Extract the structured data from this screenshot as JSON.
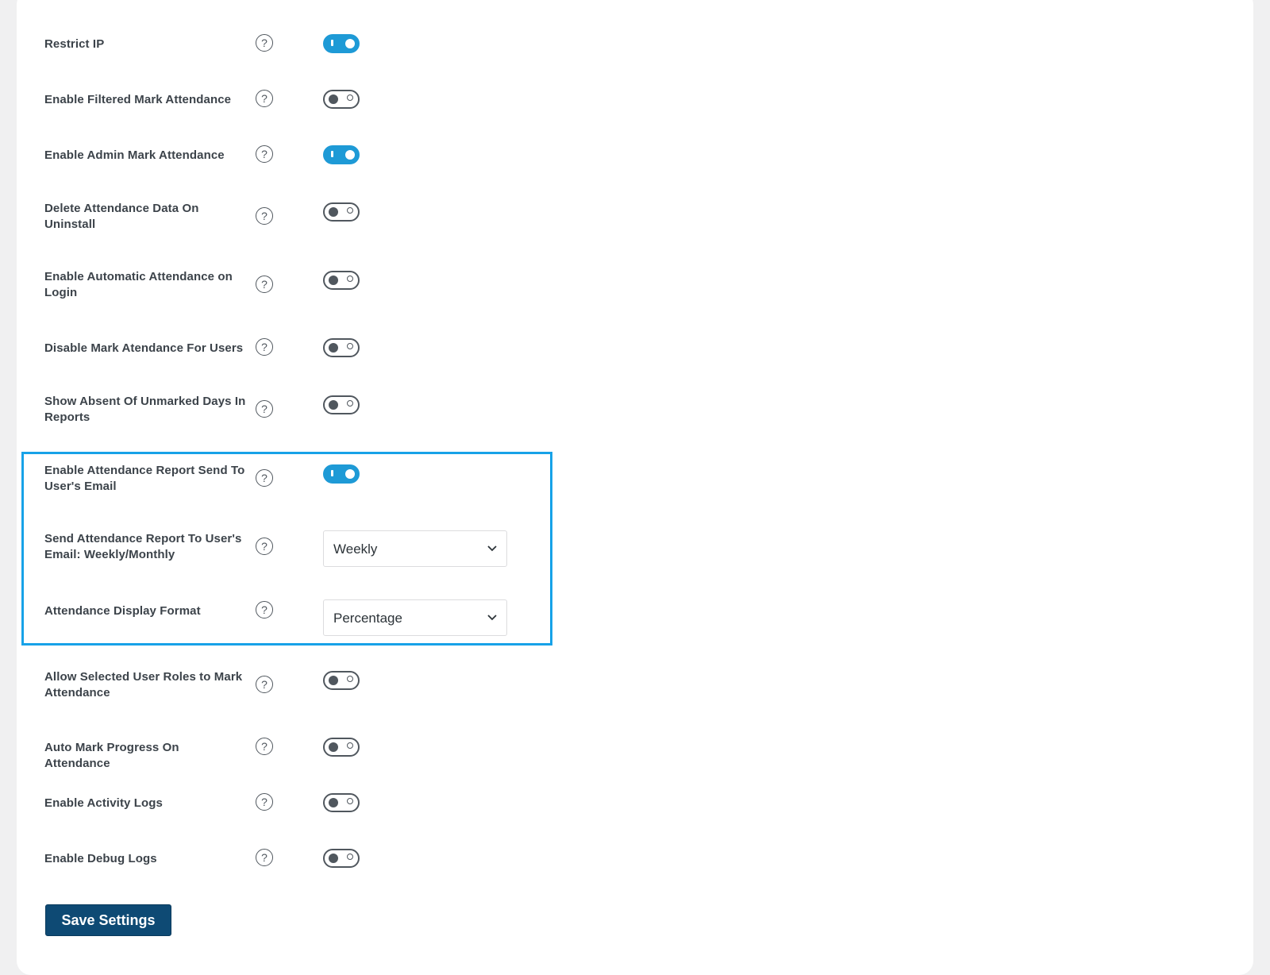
{
  "settings": [
    {
      "label": "Restrict IP",
      "control": "toggle",
      "state": "on"
    },
    {
      "label": "Enable Filtered Mark Attendance",
      "control": "toggle",
      "state": "off"
    },
    {
      "label": "Enable Admin Mark Attendance",
      "control": "toggle",
      "state": "on"
    },
    {
      "label": "Delete Attendance Data On Uninstall",
      "control": "toggle",
      "state": "off"
    },
    {
      "label": "Enable Automatic Attendance on Login",
      "control": "toggle",
      "state": "off"
    },
    {
      "label": "Disable Mark Atendance For Users",
      "control": "toggle",
      "state": "off"
    },
    {
      "label": "Show Absent Of Unmarked Days In Reports",
      "control": "toggle",
      "state": "off"
    },
    {
      "label": "Enable Attendance Report Send To User's Email",
      "control": "toggle",
      "state": "on"
    },
    {
      "label": "Send Attendance Report To User's Email: Weekly/Monthly",
      "control": "select",
      "value": "Weekly"
    },
    {
      "label": "Attendance Display Format",
      "control": "select",
      "value": "Percentage"
    },
    {
      "label": "Allow Selected User Roles to Mark Attendance",
      "control": "toggle",
      "state": "off"
    },
    {
      "label": "Auto Mark Progress On Attendance",
      "control": "toggle",
      "state": "off"
    },
    {
      "label": "Enable Activity Logs",
      "control": "toggle",
      "state": "off"
    },
    {
      "label": "Enable Debug Logs",
      "control": "toggle",
      "state": "off"
    }
  ],
  "help_glyph": "?",
  "save_label": "Save Settings",
  "colors": {
    "accent": "#1e9ad6",
    "highlight": "#17a2e8",
    "button": "#0e4a74"
  }
}
